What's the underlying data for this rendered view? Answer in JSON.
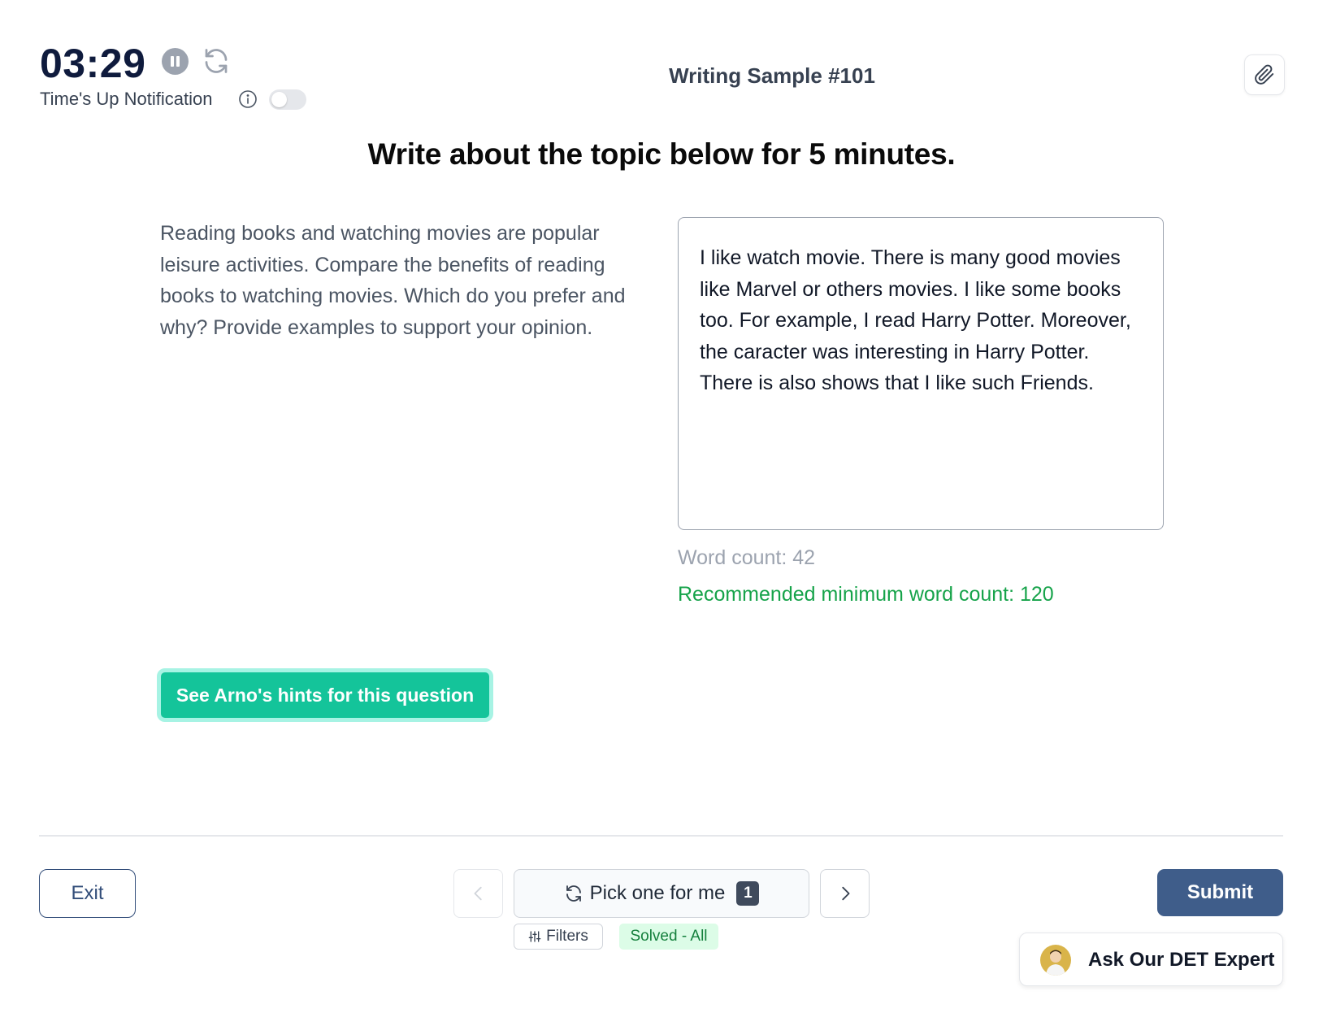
{
  "header": {
    "timer": "03:29",
    "pause_icon": "pause-icon",
    "reset_icon": "refresh-icon",
    "notification_label": "Time's Up Notification",
    "notification_enabled": false,
    "sample_title": "Writing Sample #101",
    "attach_icon": "paperclip-icon"
  },
  "main": {
    "instruction": "Write about the topic below for 5 minutes.",
    "prompt": "Reading books and watching movies are popular leisure activities. Compare the benefits of reading books to watching movies. Which do you prefer and why? Provide examples to support your opinion.",
    "essay_text": "I like watch movie. There is many good movies like Marvel or others movies. I like some books too. For example, I read Harry Potter. Moreover, the caracter was interesting in Harry Potter. There is also shows that I like such Friends.",
    "word_count": "Word count: 42",
    "recommended": "Recommended minimum word count: 120",
    "hints_button": "See Arno's hints for this question"
  },
  "footer": {
    "exit_label": "Exit",
    "pick_label": "Pick one for me",
    "pick_count": "1",
    "filters_label": "Filters",
    "solved_label": "Solved - All",
    "submit_label": "Submit",
    "expert_label": "Ask Our DET Expert"
  },
  "colors": {
    "accent_teal": "#14c49a",
    "submit_blue": "#3f5d8a",
    "success_green": "#16a34a",
    "timer_navy": "#0f1b3d"
  }
}
